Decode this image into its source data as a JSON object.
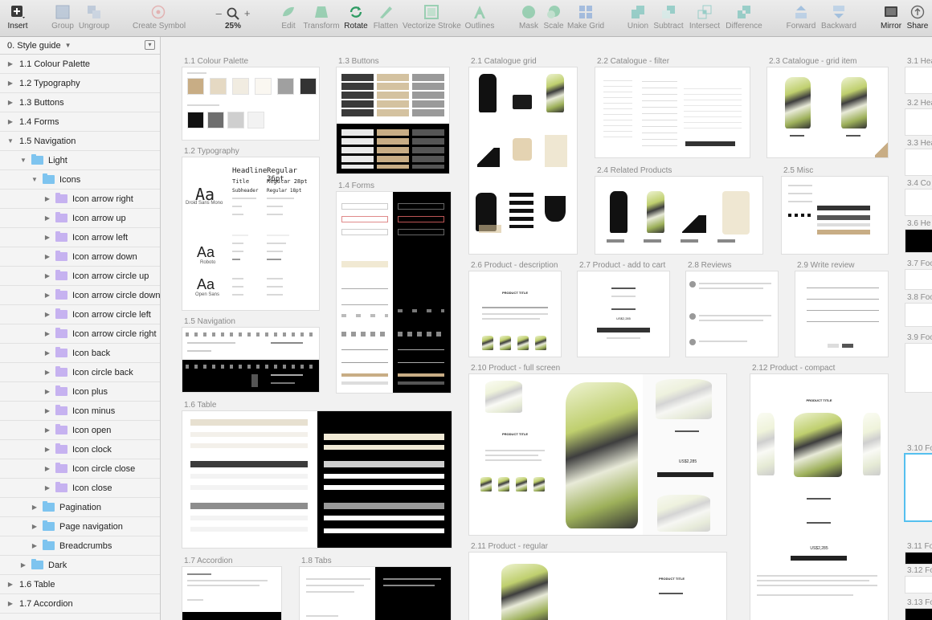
{
  "toolbar": {
    "insert": "Insert",
    "group": "Group",
    "ungroup": "Ungroup",
    "create_symbol": "Create Symbol",
    "zoom": "25%",
    "edit": "Edit",
    "transform": "Transform",
    "rotate": "Rotate",
    "flatten": "Flatten",
    "vectorize_stroke": "Vectorize Stroke",
    "outlines": "Outlines",
    "mask": "Mask",
    "scale": "Scale",
    "make_grid": "Make Grid",
    "union": "Union",
    "subtract": "Subtract",
    "intersect": "Intersect",
    "difference": "Difference",
    "forward": "Forward",
    "backward": "Backward",
    "mirror": "Mirror",
    "share": "Share",
    "zoom_minus": "–",
    "zoom_plus": "+"
  },
  "sidebar": {
    "page": "0. Style guide",
    "layers": [
      {
        "label": "1.1 Colour Palette",
        "depth": 0,
        "tri": "▶",
        "type": "none"
      },
      {
        "label": "1.2 Typography",
        "depth": 0,
        "tri": "▶",
        "type": "none"
      },
      {
        "label": "1.3 Buttons",
        "depth": 0,
        "tri": "▶",
        "type": "none"
      },
      {
        "label": "1.4 Forms",
        "depth": 0,
        "tri": "▶",
        "type": "none"
      },
      {
        "label": "1.5 Navigation",
        "depth": 0,
        "tri": "▼",
        "type": "none"
      },
      {
        "label": "Light",
        "depth": 1,
        "tri": "▼",
        "type": "folder"
      },
      {
        "label": "Icons",
        "depth": 2,
        "tri": "▼",
        "type": "folder"
      },
      {
        "label": "Icon arrow right",
        "depth": 3,
        "tri": "▶",
        "type": "symbol"
      },
      {
        "label": "Icon arrow up",
        "depth": 3,
        "tri": "▶",
        "type": "symbol"
      },
      {
        "label": "Icon arrow left",
        "depth": 3,
        "tri": "▶",
        "type": "symbol"
      },
      {
        "label": "Icon arrow down",
        "depth": 3,
        "tri": "▶",
        "type": "symbol"
      },
      {
        "label": "Icon arrow circle up",
        "depth": 3,
        "tri": "▶",
        "type": "symbol"
      },
      {
        "label": "Icon arrow circle down",
        "depth": 3,
        "tri": "▶",
        "type": "symbol"
      },
      {
        "label": "Icon arrow circle left",
        "depth": 3,
        "tri": "▶",
        "type": "symbol"
      },
      {
        "label": "Icon arrow circle right",
        "depth": 3,
        "tri": "▶",
        "type": "symbol"
      },
      {
        "label": "Icon back",
        "depth": 3,
        "tri": "▶",
        "type": "symbol"
      },
      {
        "label": "Icon circle back",
        "depth": 3,
        "tri": "▶",
        "type": "symbol"
      },
      {
        "label": "Icon plus",
        "depth": 3,
        "tri": "▶",
        "type": "symbol"
      },
      {
        "label": "Icon minus",
        "depth": 3,
        "tri": "▶",
        "type": "symbol"
      },
      {
        "label": "Icon open",
        "depth": 3,
        "tri": "▶",
        "type": "symbol"
      },
      {
        "label": "Icon clock",
        "depth": 3,
        "tri": "▶",
        "type": "symbol"
      },
      {
        "label": "Icon circle close",
        "depth": 3,
        "tri": "▶",
        "type": "symbol"
      },
      {
        "label": "Icon close",
        "depth": 3,
        "tri": "▶",
        "type": "symbol"
      },
      {
        "label": "Pagination",
        "depth": 2,
        "tri": "▶",
        "type": "folder"
      },
      {
        "label": "Page navigation",
        "depth": 2,
        "tri": "▶",
        "type": "folder"
      },
      {
        "label": "Breadcrumbs",
        "depth": 2,
        "tri": "▶",
        "type": "folder"
      },
      {
        "label": "Dark",
        "depth": 1,
        "tri": "▶",
        "type": "folder"
      },
      {
        "label": "1.6 Table",
        "depth": 0,
        "tri": "▶",
        "type": "none"
      },
      {
        "label": "1.7 Accordion",
        "depth": 0,
        "tri": "▶",
        "type": "none"
      }
    ]
  },
  "artboards": {
    "colour_palette": "1.1 Colour Palette",
    "typography": "1.2 Typography",
    "navigation": "1.5 Navigation",
    "table": "1.6 Table",
    "accordion": "1.7 Accordion",
    "buttons": "1.3 Buttons",
    "forms": "1.4 Forms",
    "tabs": "1.8 Tabs",
    "catalogue_grid": "2.1 Catalogue grid",
    "catalogue_filter": "2.2 Catalogue - filter",
    "catalogue_grid_item": "2.3 Catalogue - grid item",
    "related_products": "2.4 Related Products",
    "misc": "2.5 Misc",
    "product_description": "2.6 Product - description",
    "product_add_to_cart": "2.7 Product - add to cart",
    "reviews": "2.8 Reviews",
    "write_review": "2.9 Write review",
    "product_full_screen": "2.10 Product - full screen",
    "product_compact": "2.12 Product - compact",
    "product_regular": "2.11 Product - regular",
    "col3": [
      "3.1 Hea",
      "3.2 Hea",
      "3.3 Hea",
      "3.4 Co",
      "3.6 He",
      "3.7 Foo",
      "3.8 Foo",
      "3.9 Foo",
      "3.10 Fo",
      "3.11 Fo",
      "3.12 Fo",
      "3.13 Fo"
    ]
  },
  "typography": {
    "sample": "Aa",
    "fonts": [
      "Droid Sans Mono",
      "Roboto",
      "Open Sans"
    ],
    "styles": [
      "Headline",
      "Title",
      "Subheader"
    ],
    "sizes": [
      "Regular 36pt",
      "Regular 28pt",
      "Regular 18pt"
    ]
  },
  "product": {
    "title": "PRODUCT TITLE",
    "price": "US$2,285"
  },
  "palette": {
    "warm": [
      "#c8ad85",
      "#e5d9c3",
      "#f1ece1",
      "#faf7f1",
      "#a0a0a0",
      "#333333"
    ],
    "gray": [
      "#111111",
      "#6e6e6e",
      "#cfcfcf",
      "#f2f2f2"
    ]
  }
}
